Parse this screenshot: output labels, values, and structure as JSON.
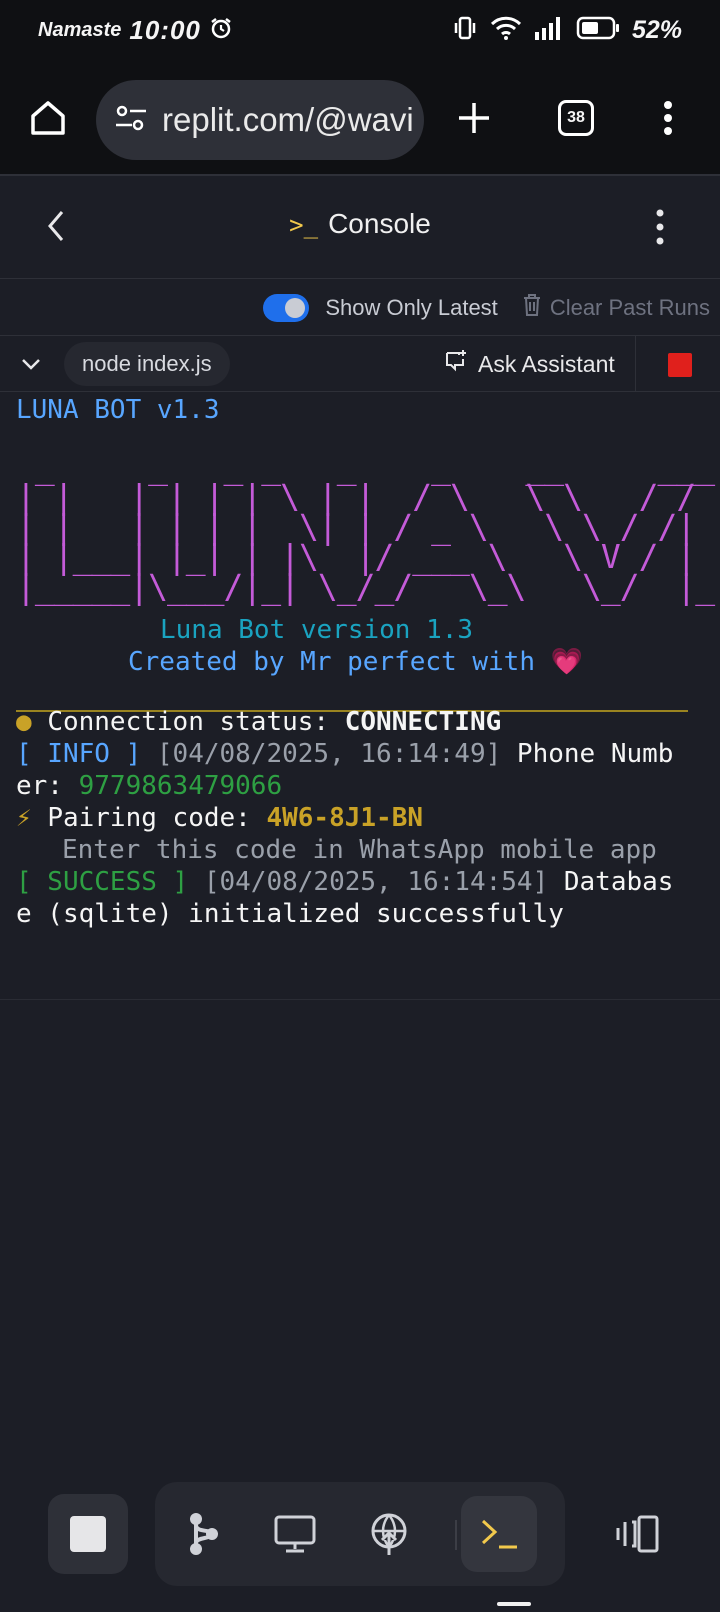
{
  "status_bar": {
    "carrier": "Namaste",
    "time": "10:00",
    "battery": "52%"
  },
  "browser": {
    "url": "replit.com/@wavi",
    "tab_count": "38"
  },
  "header": {
    "title": "Console",
    "prompt_glyph": ">_"
  },
  "toolbar": {
    "show_latest_label": "Show Only Latest",
    "show_latest_on": true,
    "clear_label": "Clear Past Runs"
  },
  "runbar": {
    "command": "node index.js",
    "assistant_label": "Ask Assistant"
  },
  "console": {
    "header_line": "LUNA BOT v1.3",
    "banner": " _     _   _ _   _    _    __     ___ \n| |   | | | | \\ | |  / \\   \\ \\   / / |\n| |   | | | |  \\| | / _ \\   \\ \\ / /| |\n| |___| |_| | |\\  |/ ___ \\   \\ V / | |\n|_____|\\___/|_| \\_/_/   \\_\\   \\_/  |_|",
    "version_line": "Luna Bot version 1.3",
    "created_line": "Created by Mr perfect with 💗",
    "status_dot": "●",
    "status_label": "Connection status: ",
    "status_value": "CONNECTING",
    "info_tag": "[ INFO ]",
    "info_time": "[04/08/2025, 16:14:49]",
    "info_msg_a": "Phone Numb",
    "info_msg_b": "er: ",
    "phone": "9779863479066",
    "pair_icon": "⚡",
    "pair_label": "Pairing code: ",
    "pair_code": "4W6-8J1-BN",
    "pair_hint": "Enter this code in WhatsApp mobile app",
    "success_tag": "[ SUCCESS ]",
    "success_time": "[04/08/2025, 16:14:54]",
    "success_msg_a": "Databas",
    "success_msg_b": "e (sqlite) initialized successfully"
  },
  "colors": {
    "accent": "#1f6feb",
    "banner": "#c45bd8",
    "stop": "#e0201c",
    "prompt": "#f2c94c"
  },
  "icons": {
    "home": "home-icon",
    "site_settings": "tune-icon",
    "new_tab": "plus-icon",
    "menu": "more-vert-icon",
    "back": "chevron-left-icon",
    "trash": "trash-icon",
    "assistant": "chat-sparkle-icon",
    "collapse": "chevron-down-icon",
    "nav_git": "git-icon",
    "nav_preview": "monitor-icon",
    "nav_deploy": "globe-upload-icon",
    "nav_console": "terminal-icon",
    "nav_panels": "panels-icon"
  }
}
